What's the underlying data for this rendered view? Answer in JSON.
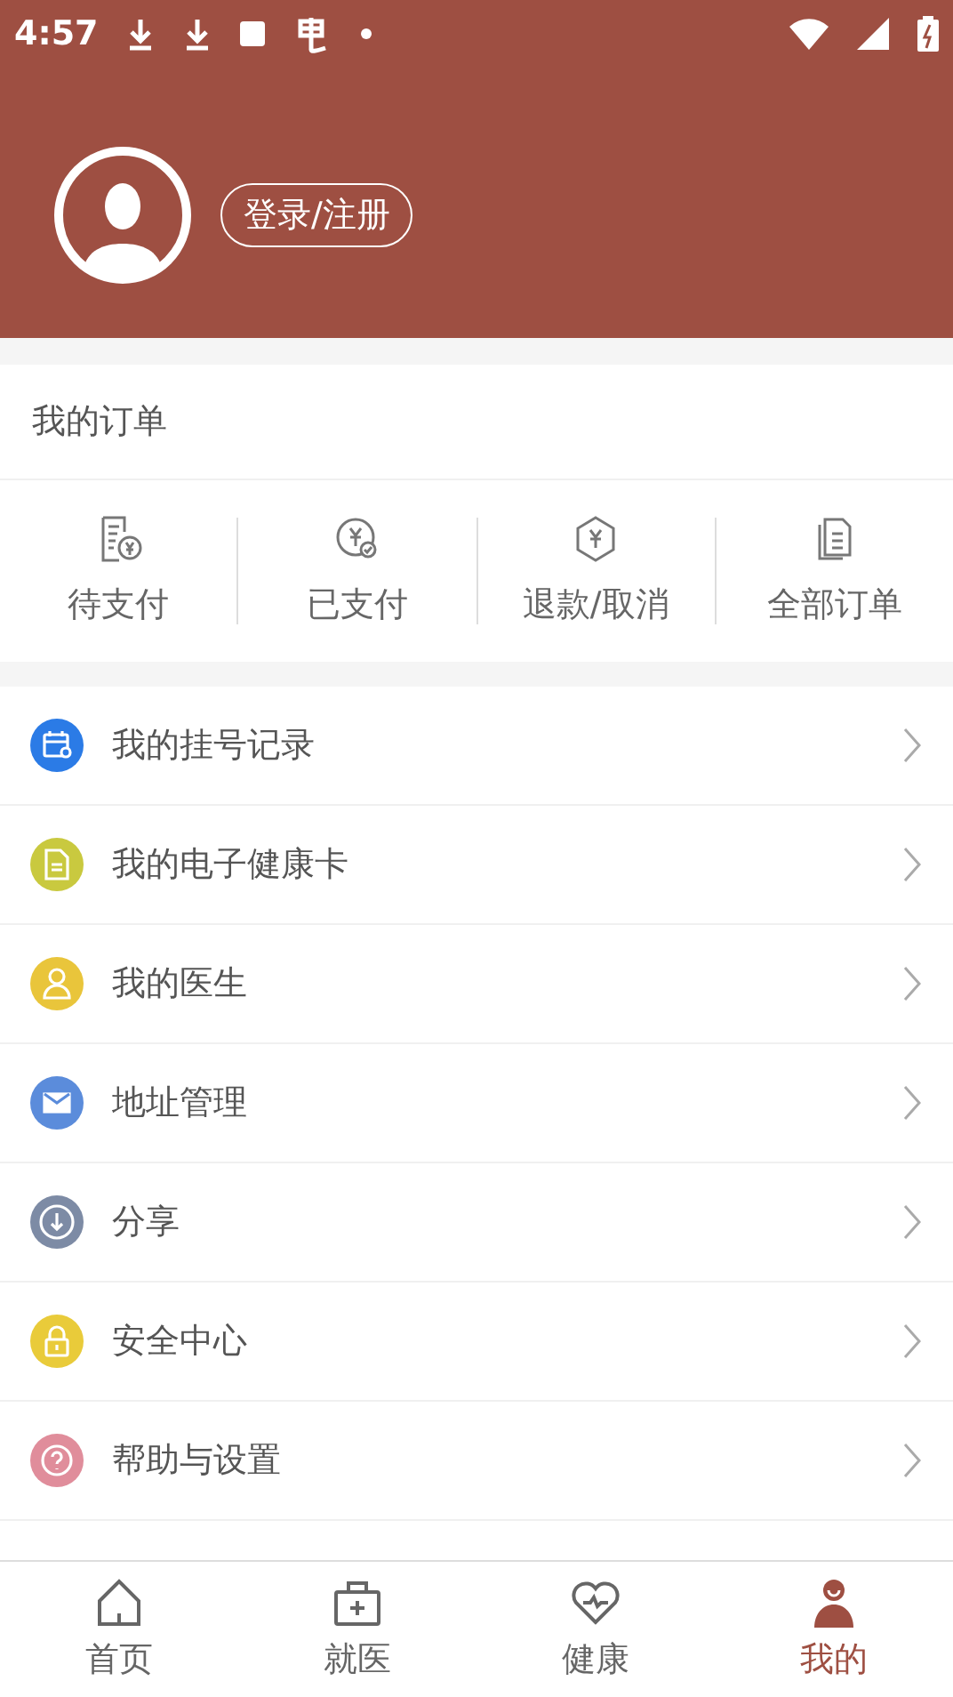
{
  "status_bar": {
    "time": "4:57"
  },
  "header": {
    "login_button": "登录/注册"
  },
  "orders": {
    "title": "我的订单",
    "items": [
      {
        "kind": "pending",
        "label": "待支付"
      },
      {
        "kind": "paid",
        "label": "已支付"
      },
      {
        "kind": "refund",
        "label": "退款/取消"
      },
      {
        "kind": "all",
        "label": "全部订单"
      }
    ]
  },
  "menu": [
    {
      "kind": "calendar",
      "label": "我的挂号记录",
      "color": "#2b7be6"
    },
    {
      "kind": "card",
      "label": "我的电子健康卡",
      "color": "#c9c93f"
    },
    {
      "kind": "doctor",
      "label": "我的医生",
      "color": "#e9c53b"
    },
    {
      "kind": "mail",
      "label": "地址管理",
      "color": "#5b8cdb"
    },
    {
      "kind": "share",
      "label": "分享",
      "color": "#7d8ba5"
    },
    {
      "kind": "lock",
      "label": "安全中心",
      "color": "#e9cb3a"
    },
    {
      "kind": "help",
      "label": "帮助与设置",
      "color": "#e08d9b"
    }
  ],
  "tabs": [
    {
      "kind": "home",
      "label": "首页",
      "selected": false
    },
    {
      "kind": "medical",
      "label": "就医",
      "selected": false
    },
    {
      "kind": "health",
      "label": "健康",
      "selected": false
    },
    {
      "kind": "me",
      "label": "我的",
      "selected": true
    }
  ]
}
